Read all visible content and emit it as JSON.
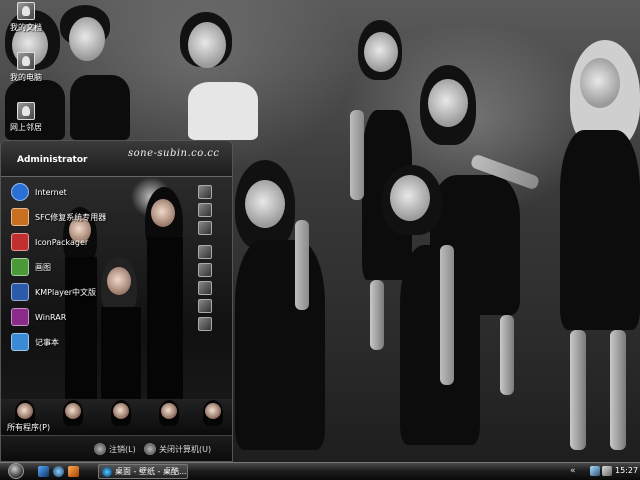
{
  "desktop": {
    "icons": [
      {
        "label": "我的文档",
        "icon": "my-documents-icon"
      },
      {
        "label": "我的电脑",
        "icon": "my-computer-icon"
      },
      {
        "label": "网上邻居",
        "icon": "network-places-icon"
      }
    ],
    "watermark": "sone-subin.co.cc"
  },
  "start_menu": {
    "user": "Administrator",
    "programs": [
      {
        "label": "Internet",
        "icon": "internet-explorer-icon",
        "color": "#2a6fd6"
      },
      {
        "label": "SFC修复系统专用器",
        "icon": "sfc-icon",
        "color": "#c87020"
      },
      {
        "label": "IconPackager",
        "icon": "iconpackager-icon",
        "color": "#c03030"
      },
      {
        "label": "画图",
        "icon": "paint-icon",
        "color": "#4a9a3a"
      },
      {
        "label": "KMPlayer中文版",
        "icon": "kmplayer-icon",
        "color": "#2a5aa8"
      },
      {
        "label": "WinRAR",
        "icon": "winrar-icon",
        "color": "#8a2a8a"
      },
      {
        "label": "记事本",
        "icon": "notepad-icon",
        "color": "#3a8ad6"
      }
    ],
    "all_programs": "所有程序(P)",
    "logoff": "注销(L)",
    "shutdown": "关闭计算机(U)"
  },
  "taskbar": {
    "task_label": "桌面 - 壁纸 - 桌酷...",
    "tray_arrow": "«",
    "clock": "15:27"
  },
  "colors": {
    "taskbar": "#1d1d1d",
    "menu_background": "#121212"
  }
}
